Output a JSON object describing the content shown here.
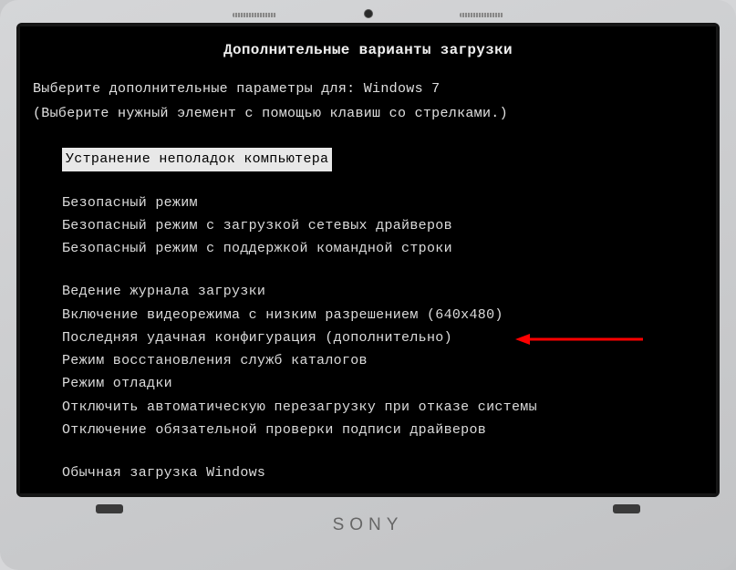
{
  "header": {
    "title": "Дополнительные варианты загрузки"
  },
  "instructions": {
    "line1": "Выберите дополнительные параметры для: Windows 7",
    "line2": "(Выберите нужный элемент с помощью клавиш со стрелками.)"
  },
  "menu": {
    "selected_index": 0,
    "group1": {
      "item0": "Устранение неполадок компьютера"
    },
    "group2": {
      "item0": "Безопасный режим",
      "item1": "Безопасный режим с загрузкой сетевых драйверов",
      "item2": "Безопасный режим с поддержкой командной строки"
    },
    "group3": {
      "item0": "Ведение журнала загрузки",
      "item1": "Включение видеорежима с низким разрешением (640x480)",
      "item2": "Последняя удачная конфигурация (дополнительно)",
      "item3": "Режим восстановления служб каталогов",
      "item4": "Режим отладки",
      "item5": "Отключить автоматическую перезагрузку при отказе системы",
      "item6": "Отключение обязательной проверки подписи драйверов"
    },
    "group4": {
      "item0": "Обычная загрузка Windows"
    }
  },
  "brand": "SONY"
}
